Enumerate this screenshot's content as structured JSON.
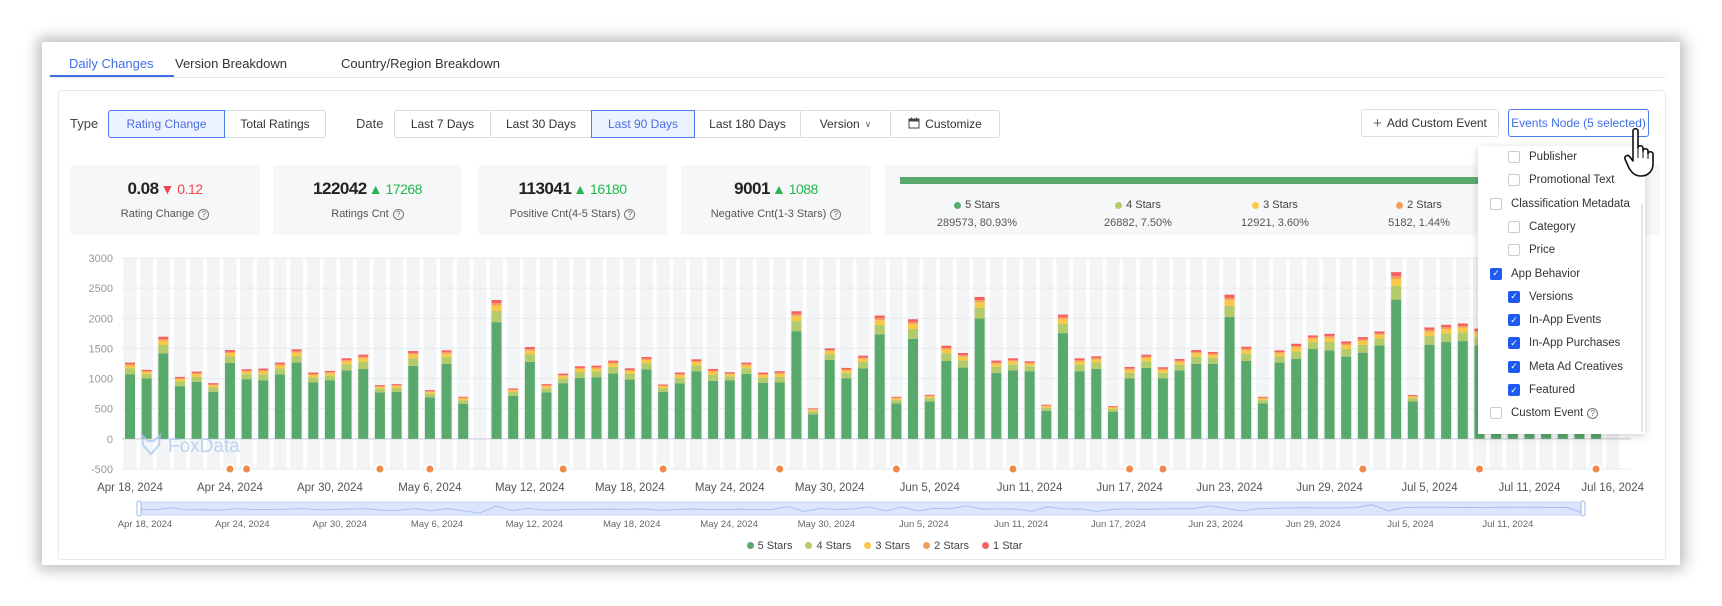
{
  "tabs": [
    {
      "label": "Daily Changes",
      "active": true
    },
    {
      "label": "Version Breakdown"
    },
    {
      "label": "Country/Region Breakdown"
    }
  ],
  "filters": {
    "type_label": "Type",
    "type_options": [
      {
        "label": "Rating Change",
        "selected": true
      },
      {
        "label": "Total Ratings"
      }
    ],
    "date_label": "Date",
    "date_options": [
      {
        "label": "Last 7 Days"
      },
      {
        "label": "Last 30 Days"
      },
      {
        "label": "Last 90 Days",
        "selected": true
      },
      {
        "label": "Last 180 Days"
      },
      {
        "label": "Version"
      },
      {
        "label": "Customize"
      }
    ],
    "add_custom_event": "Add Custom Event",
    "events_node": "Events Node (5 selected)"
  },
  "stats": [
    {
      "value": "0.08",
      "delta": "0.12",
      "direction": "down",
      "label": "Rating Change"
    },
    {
      "value": "122042",
      "delta": "17268",
      "direction": "up",
      "label": "Ratings Cnt"
    },
    {
      "value": "113041",
      "delta": "16180",
      "direction": "up",
      "label": "Positive Cnt(4-5 Stars)"
    },
    {
      "value": "9001",
      "delta": "1088",
      "direction": "up",
      "label": "Negative Cnt(1-3 Stars)"
    }
  ],
  "distribution": [
    {
      "label": "5 Stars",
      "value": "289573, 80.93%",
      "color": "#5aa96c"
    },
    {
      "label": "4 Stars",
      "value": "26882, 7.50%",
      "color": "#b3cb6b"
    },
    {
      "label": "3 Stars",
      "value": "12921, 3.60%",
      "color": "#f8c948"
    },
    {
      "label": "2 Stars",
      "value": "5182, 1.44%",
      "color": "#f5a05a"
    }
  ],
  "events_dropdown": [
    {
      "label": "Publisher",
      "checked": false,
      "level": 2
    },
    {
      "label": "Promotional Text",
      "checked": false,
      "level": 2
    },
    {
      "label": "Classification Metadata",
      "checked": false,
      "level": 1
    },
    {
      "label": "Category",
      "checked": false,
      "level": 2
    },
    {
      "label": "Price",
      "checked": false,
      "level": 2
    },
    {
      "label": "App Behavior",
      "checked": true,
      "level": 1
    },
    {
      "label": "Versions",
      "checked": true,
      "level": 2
    },
    {
      "label": "In-App Events",
      "checked": true,
      "level": 2
    },
    {
      "label": "In-App Purchases",
      "checked": true,
      "level": 2
    },
    {
      "label": "Meta Ad Creatives",
      "checked": true,
      "level": 2
    },
    {
      "label": "Featured",
      "checked": true,
      "level": 2
    },
    {
      "label": "Custom Event",
      "checked": false,
      "level": 1,
      "help": true
    }
  ],
  "watermark": "FoxData",
  "chart_data": {
    "type": "bar",
    "stacked": true,
    "ylim": [
      -500,
      3000
    ],
    "y_ticks": [
      "3000",
      "2500",
      "2000",
      "1500",
      "1000",
      "500",
      "0",
      "-500"
    ],
    "grid": true,
    "legend_position": "bottom",
    "x_tick_labels": [
      "Apr 18, 2024",
      "Apr 24, 2024",
      "Apr 30, 2024",
      "May 6, 2024",
      "May 12, 2024",
      "May 18, 2024",
      "May 24, 2024",
      "May 30, 2024",
      "Jun 5, 2024",
      "Jun 11, 2024",
      "Jun 17, 2024",
      "Jun 23, 2024",
      "Jun 29, 2024",
      "Jul 5, 2024",
      "Jul 11, 2024",
      "Jul 16, 2024"
    ],
    "slider_labels": [
      "Apr 18, 2024",
      "Apr 24, 2024",
      "Apr 30, 2024",
      "May 6, 2024",
      "May 12, 2024",
      "May 18, 2024",
      "May 24, 2024",
      "May 30, 2024",
      "Jun 5, 2024",
      "Jun 11, 2024",
      "Jun 17, 2024",
      "Jun 23, 2024",
      "Jun 29, 2024",
      "Jul 5, 2024",
      "Jul 11, 2024"
    ],
    "categories": [
      "2024-04-18",
      "2024-04-19",
      "2024-04-20",
      "2024-04-21",
      "2024-04-22",
      "2024-04-23",
      "2024-04-24",
      "2024-04-25",
      "2024-04-26",
      "2024-04-27",
      "2024-04-28",
      "2024-04-29",
      "2024-04-30",
      "2024-05-01",
      "2024-05-02",
      "2024-05-03",
      "2024-05-04",
      "2024-05-05",
      "2024-05-06",
      "2024-05-07",
      "2024-05-08",
      "2024-05-09",
      "2024-05-10",
      "2024-05-11",
      "2024-05-12",
      "2024-05-13",
      "2024-05-14",
      "2024-05-15",
      "2024-05-16",
      "2024-05-17",
      "2024-05-18",
      "2024-05-19",
      "2024-05-20",
      "2024-05-21",
      "2024-05-22",
      "2024-05-23",
      "2024-05-24",
      "2024-05-25",
      "2024-05-26",
      "2024-05-27",
      "2024-05-28",
      "2024-05-29",
      "2024-05-30",
      "2024-05-31",
      "2024-06-01",
      "2024-06-02",
      "2024-06-03",
      "2024-06-04",
      "2024-06-05",
      "2024-06-06",
      "2024-06-07",
      "2024-06-08",
      "2024-06-09",
      "2024-06-10",
      "2024-06-11",
      "2024-06-12",
      "2024-06-13",
      "2024-06-14",
      "2024-06-15",
      "2024-06-16",
      "2024-06-17",
      "2024-06-18",
      "2024-06-19",
      "2024-06-20",
      "2024-06-21",
      "2024-06-22",
      "2024-06-23",
      "2024-06-24",
      "2024-06-25",
      "2024-06-26",
      "2024-06-27",
      "2024-06-28",
      "2024-06-29",
      "2024-06-30",
      "2024-07-01",
      "2024-07-02",
      "2024-07-03",
      "2024-07-04",
      "2024-07-05",
      "2024-07-06",
      "2024-07-07",
      "2024-07-08",
      "2024-07-09",
      "2024-07-10",
      "2024-07-11",
      "2024-07-12",
      "2024-07-13",
      "2024-07-14",
      "2024-07-15",
      "2024-07-16"
    ],
    "series": [
      {
        "name": "5 Stars",
        "color": "#5aa96c",
        "values": [
          1072,
          1001,
          1419,
          874,
          946,
          781,
          1259,
          990,
          973,
          1067,
          1265,
          935,
          973,
          1133,
          1160,
          770,
          781,
          1210,
          687,
          1243,
          583,
          0,
          1936,
          715,
          1276,
          770,
          924,
          1012,
          1023,
          1083,
          984,
          1155,
          781,
          919,
          1122,
          962,
          973,
          1078,
          929,
          935,
          1787,
          407,
          1309,
          1001,
          1171,
          1732,
          588,
          1661,
          621,
          1292,
          1182,
          1996,
          1094,
          1138,
          1122,
          467,
          1754,
          1122,
          1160,
          451,
          1001,
          1177,
          1006,
          1133,
          1243,
          1243,
          2024,
          1292,
          588,
          1265,
          1325,
          1490,
          1468,
          1364,
          1430,
          1551,
          2310,
          621,
          1562,
          1606,
          1622,
          1550,
          1600,
          1500,
          1650,
          1580,
          1620,
          1540,
          1600,
          0
        ]
      },
      {
        "name": "4 Stars",
        "color": "#b3cb6b",
        "values": [
          97,
          72,
          138,
          77,
          85,
          72,
          108,
          83,
          97,
          99,
          110,
          83,
          77,
          102,
          119,
          61,
          63,
          124,
          61,
          113,
          58,
          0,
          184,
          61,
          124,
          69,
          80,
          96,
          96,
          108,
          94,
          102,
          61,
          91,
          99,
          99,
          66,
          94,
          86,
          94,
          165,
          50,
          96,
          88,
          105,
          157,
          55,
          162,
          55,
          127,
          121,
          179,
          102,
          99,
          83,
          50,
          154,
          107,
          105,
          47,
          96,
          110,
          91,
          96,
          116,
          99,
          184,
          119,
          55,
          102,
          127,
          113,
          138,
          127,
          129,
          116,
          228,
          53,
          143,
          143,
          146,
          140,
          140,
          140,
          140,
          140,
          140,
          140,
          140,
          0
        ]
      },
      {
        "name": "3 Stars",
        "color": "#f8c948",
        "values": [
          48,
          36,
          69,
          39,
          43,
          36,
          54,
          41,
          48,
          50,
          55,
          41,
          39,
          51,
          59,
          30,
          32,
          62,
          30,
          56,
          29,
          0,
          92,
          30,
          62,
          34,
          40,
          48,
          48,
          54,
          47,
          51,
          30,
          45,
          50,
          50,
          33,
          47,
          43,
          47,
          83,
          25,
          48,
          44,
          52,
          79,
          28,
          81,
          28,
          63,
          61,
          90,
          51,
          50,
          41,
          25,
          77,
          54,
          52,
          23,
          48,
          55,
          46,
          48,
          58,
          50,
          92,
          59,
          28,
          51,
          63,
          57,
          69,
          63,
          65,
          58,
          114,
          26,
          72,
          72,
          73,
          70,
          70,
          70,
          70,
          70,
          70,
          70,
          70,
          0
        ]
      },
      {
        "name": "2 Stars",
        "color": "#f5a05a",
        "values": [
          19,
          14,
          28,
          15,
          17,
          14,
          22,
          17,
          19,
          20,
          22,
          17,
          15,
          20,
          24,
          12,
          13,
          25,
          12,
          23,
          12,
          0,
          37,
          12,
          25,
          14,
          16,
          19,
          19,
          22,
          19,
          20,
          12,
          18,
          20,
          20,
          13,
          19,
          17,
          19,
          33,
          10,
          19,
          18,
          21,
          31,
          11,
          32,
          11,
          25,
          24,
          36,
          20,
          20,
          17,
          10,
          31,
          21,
          21,
          9,
          19,
          22,
          18,
          19,
          23,
          20,
          37,
          24,
          11,
          20,
          25,
          23,
          28,
          25,
          26,
          23,
          46,
          11,
          29,
          29,
          29,
          28,
          28,
          28,
          28,
          28,
          28,
          28,
          28,
          0
        ]
      },
      {
        "name": "1 Star",
        "color": "#f56262",
        "values": [
          29,
          21,
          40,
          23,
          25,
          21,
          31,
          24,
          29,
          29,
          33,
          24,
          23,
          30,
          35,
          18,
          18,
          36,
          18,
          33,
          16,
          0,
          55,
          18,
          36,
          20,
          23,
          29,
          29,
          31,
          27,
          30,
          18,
          27,
          29,
          29,
          20,
          27,
          25,
          27,
          49,
          14,
          29,
          26,
          31,
          47,
          16,
          49,
          16,
          38,
          36,
          53,
          31,
          29,
          24,
          14,
          46,
          32,
          31,
          14,
          29,
          33,
          27,
          29,
          34,
          29,
          55,
          35,
          16,
          30,
          38,
          33,
          40,
          38,
          38,
          34,
          68,
          15,
          42,
          42,
          44,
          42,
          42,
          42,
          42,
          42,
          42,
          42,
          42,
          0
        ]
      }
    ],
    "event_markers": [
      "2024-04-24",
      "2024-04-25",
      "2024-05-03",
      "2024-05-06",
      "2024-05-14",
      "2024-05-20",
      "2024-05-27",
      "2024-06-03",
      "2024-06-10",
      "2024-06-17",
      "2024-06-19",
      "2024-07-01",
      "2024-07-08",
      "2024-07-15"
    ],
    "event_marker_color": "#f08a4b"
  },
  "colors": {
    "accent": "#3f6ee8",
    "selected_bg": "#edf2ff"
  }
}
